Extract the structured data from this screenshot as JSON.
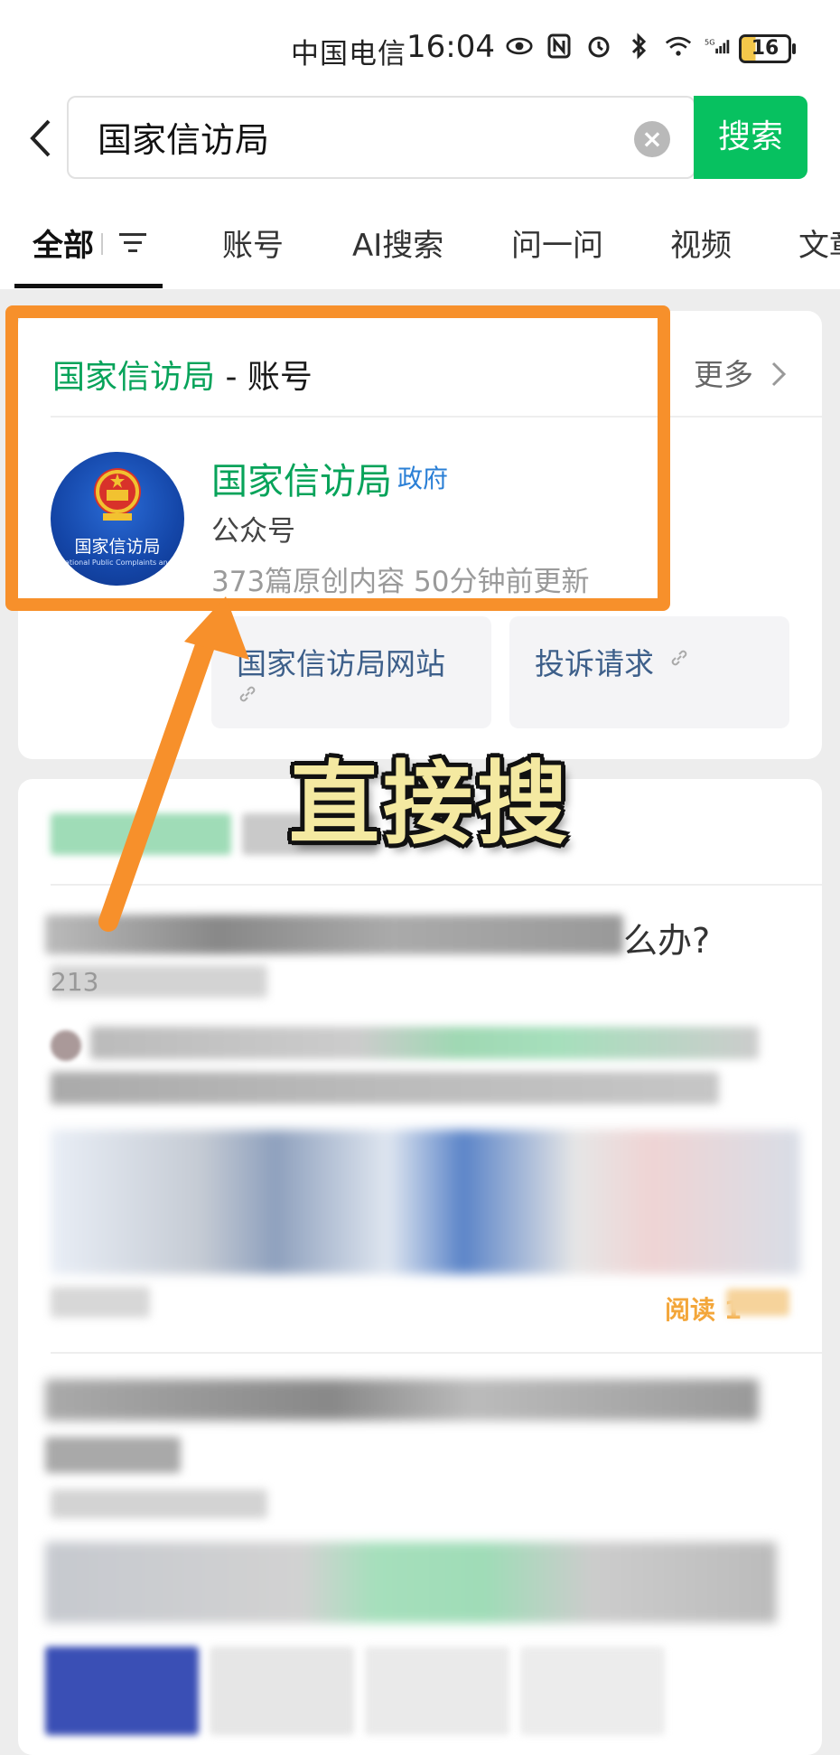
{
  "status_bar": {
    "carrier": "中国电信",
    "time": "16:04",
    "battery": "16"
  },
  "search": {
    "query": "国家信访局",
    "button_label": "搜索"
  },
  "tabs": [
    {
      "label": "全部"
    },
    {
      "label": "账号"
    },
    {
      "label": "AI搜索"
    },
    {
      "label": "问一问"
    },
    {
      "label": "视频"
    },
    {
      "label": "文章"
    }
  ],
  "account_section": {
    "title_highlight": "国家信访局",
    "title_suffix": " - 账号",
    "more_label": "更多",
    "account": {
      "name": "国家信访局",
      "tag": "政府",
      "type": "公众号",
      "stats": "373篇原创内容  50分钟前更新",
      "avatar_text": "国家信访局",
      "avatar_subtext": "National Public Complaints and Proposals Administration"
    },
    "links": [
      {
        "label": "国家信访局网站"
      },
      {
        "label": "投诉请求"
      }
    ]
  },
  "annotation": {
    "overlay_text": "直接搜"
  },
  "blurred_section": {
    "visible_question_mark": "么办?",
    "visible_number": "213",
    "read_label": "阅读 1"
  },
  "colors": {
    "accent_green": "#07c160",
    "link_green": "#07a35a",
    "highlight_orange": "#f7902b",
    "gov_blue": "#2a7fd6"
  }
}
